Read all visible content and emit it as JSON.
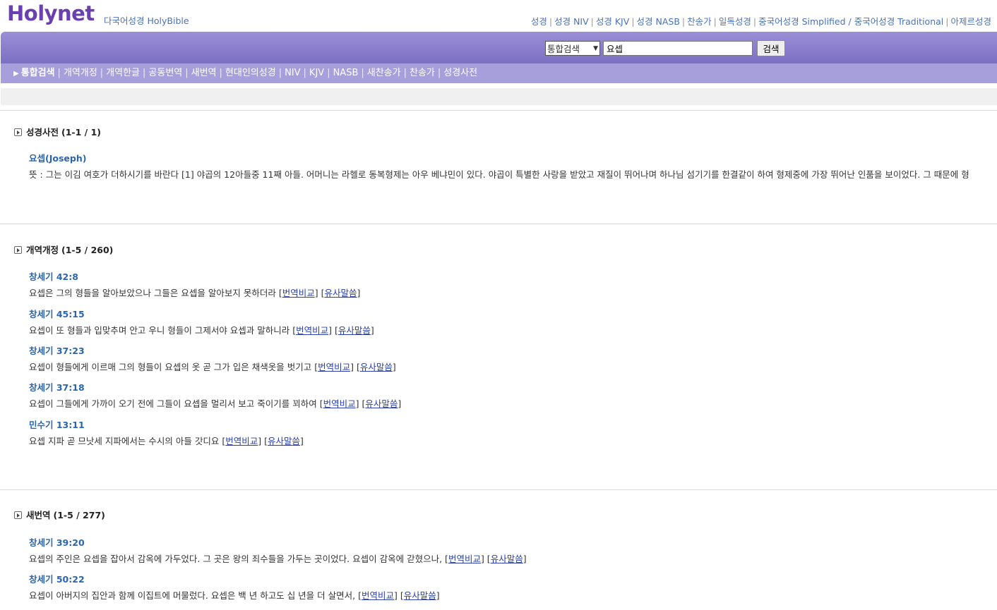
{
  "header": {
    "logo": "Holynet",
    "subtitle": "다국어성경 HolyBible",
    "links": [
      "성경",
      "성경 NIV",
      "성경 KJV",
      "성경 NASB",
      "찬송가",
      "일독성경",
      "중국어성경 Simplified / 중국어성경 Traditional",
      "아제르성경"
    ]
  },
  "search": {
    "select_value": "통합검색",
    "input_value": "요셉",
    "button_label": "검색"
  },
  "tabs": [
    "통합검색",
    "개역개정",
    "개역한글",
    "공동번역",
    "새번역",
    "현대인의성경",
    "NIV",
    "KJV",
    "NASB",
    "새찬송가",
    "찬송가",
    "성경사전"
  ],
  "compare_label": "번역비교",
  "similar_label": "유사말씀",
  "sections": [
    {
      "title": "성경사전",
      "count": "(1-1 / 1)",
      "entries": [
        {
          "title": "요셉(Joseph)",
          "text": "뜻 : 그는 이김 여호가 더하시기를 바란다 [1] 야곱의 12아들중 11째 아들. 어머니는 라헬로 동복형제는 아우 베냐민이 있다. 야곱이 특별한 사랑을 받았고 재질이 뛰어나며 하나님 섬기기를 한결같이 하여 형제중에 가장 뛰어난 인품을 보이었다. 그 때문에 형"
        }
      ]
    },
    {
      "title": "개역개정",
      "count": "(1-5 / 260)",
      "entries": [
        {
          "title": "창세기 42:8",
          "text": "요셉은 그의 형들을 알아보았으나 그들은 요셉을 알아보지 못하더라"
        },
        {
          "title": "창세기 45:15",
          "text": "요셉이 또 형들과 입맞추며 안고 우니 형들이 그제서야 요셉과 말하니라"
        },
        {
          "title": "창세기 37:23",
          "text": "요셉이 형들에게 이르매 그의 형들이 요셉의 옷 곧 그가 입은 채색옷을 벗기고"
        },
        {
          "title": "창세기 37:18",
          "text": "요셉이 그들에게 가까이 오기 전에 그들이 요셉을 멀리서 보고 죽이기를 꾀하여"
        },
        {
          "title": "민수기 13:11",
          "text": "요셉 지파 곧 므낫세 지파에서는 수시의 아들 갓디요"
        }
      ]
    },
    {
      "title": "새번역",
      "count": "(1-5 / 277)",
      "entries": [
        {
          "title": "창세기 39:20",
          "text": "요셉의 주인은 요셉을 잡아서 감옥에 가두었다. 그 곳은 왕의 죄수들을 가두는 곳이었다. 요셉이 감옥에 갇혔으나,"
        },
        {
          "title": "창세기 50:22",
          "text": "요셉이 아버지의 집안과 함께 이집트에 머물렀다. 요셉은 백 년 하고도 십 년을 더 살면서,"
        }
      ]
    }
  ],
  "colors": {
    "accent": "#7c6fc4",
    "tabbar": "#a79fdc",
    "link": "#2a65b0",
    "logo": "#6a3fb0"
  }
}
